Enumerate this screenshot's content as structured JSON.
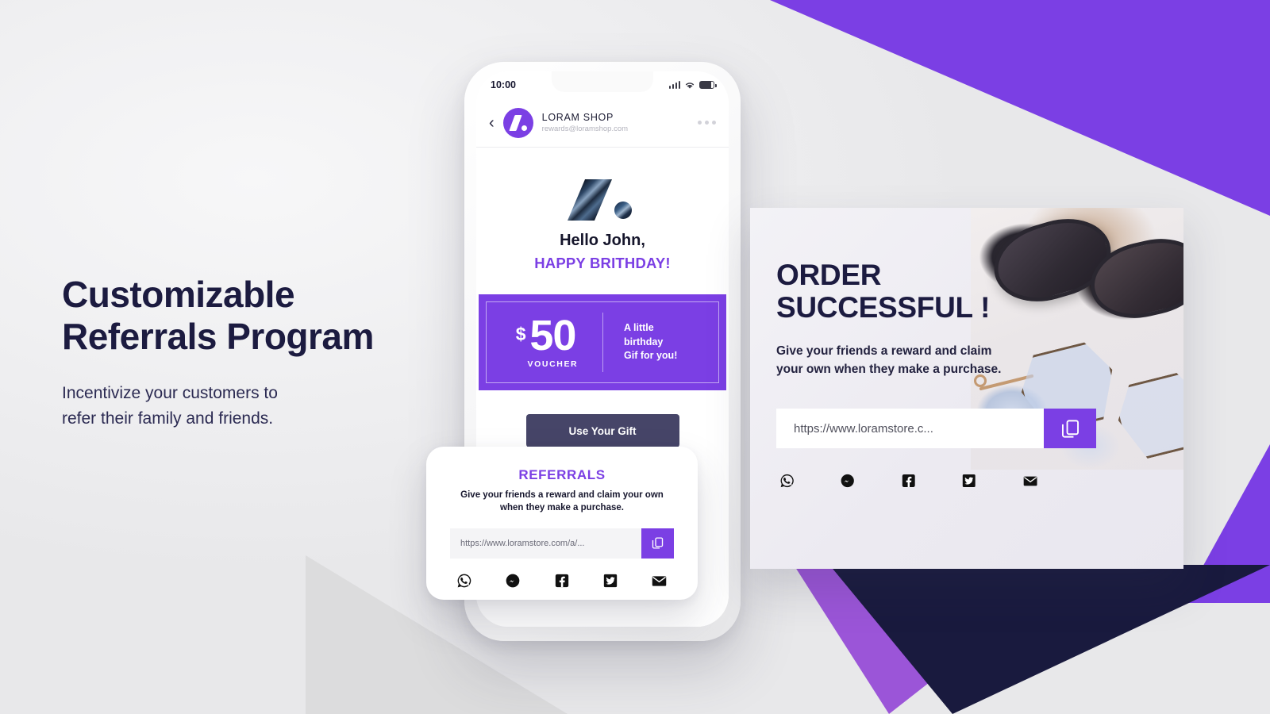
{
  "left": {
    "headline_line1": "Customizable",
    "headline_line2": "Referrals Program",
    "sub_line1": "Incentivize your customers to",
    "sub_line2": "refer their family and friends."
  },
  "phone": {
    "status": {
      "time": "10:00"
    },
    "mail_header": {
      "sender_name": "LORAM SHOP",
      "sender_email": "rewards@loramshop.com"
    },
    "body": {
      "greeting": "Hello John,",
      "birthday": "HAPPY BRITHDAY!",
      "voucher": {
        "currency": "$",
        "amount": "50",
        "label": "VOUCHER",
        "note_line1": "A little",
        "note_line2": "birthday",
        "note_line3": "Gif for you!"
      },
      "cta_label": "Use Your Gift"
    }
  },
  "referral_card": {
    "title": "REFERRALS",
    "subtitle": "Give your friends a reward and claim your own when they make a purchase.",
    "link_value": "https://www.loramstore.com/a/...",
    "social": [
      "whatsapp-icon",
      "messenger-icon",
      "facebook-icon",
      "twitter-icon",
      "email-icon"
    ]
  },
  "right_panel": {
    "title_line1": "ORDER",
    "title_line2": "SUCCESSFUL !",
    "subtitle": "Give your friends a reward and claim your own when they make a purchase.",
    "link_value": "https://www.loramstore.c...",
    "social": [
      "whatsapp-icon",
      "messenger-icon",
      "facebook-icon",
      "twitter-icon",
      "email-icon"
    ]
  },
  "colors": {
    "accent_purple": "#7b3fe4",
    "mid_purple": "#9b55d8",
    "navy": "#1c1b40",
    "button_slate": "#464568",
    "background": "#f0f0f1"
  }
}
